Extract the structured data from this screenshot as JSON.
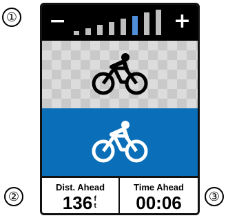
{
  "callouts": [
    "①",
    "②",
    "③"
  ],
  "top_bar": {
    "minus_symbol": "−",
    "plus_symbol": "+",
    "level_count": 8,
    "selected_level": 6,
    "colors": {
      "selected": "#4f8fd9",
      "unselected": "#bfbfbf"
    }
  },
  "activity_profiles": [
    {
      "icon": "cyclist-icon",
      "selected": false,
      "background": "gray pattern"
    },
    {
      "icon": "cyclist-icon",
      "selected": true,
      "background": "#0a6fb8"
    }
  ],
  "data_fields": {
    "distance_ahead": {
      "label": "Dist. Ahead",
      "value": "136",
      "unit_top": "f",
      "unit_bottom": "t"
    },
    "time_ahead": {
      "label": "Time Ahead",
      "value": "00:06"
    }
  }
}
